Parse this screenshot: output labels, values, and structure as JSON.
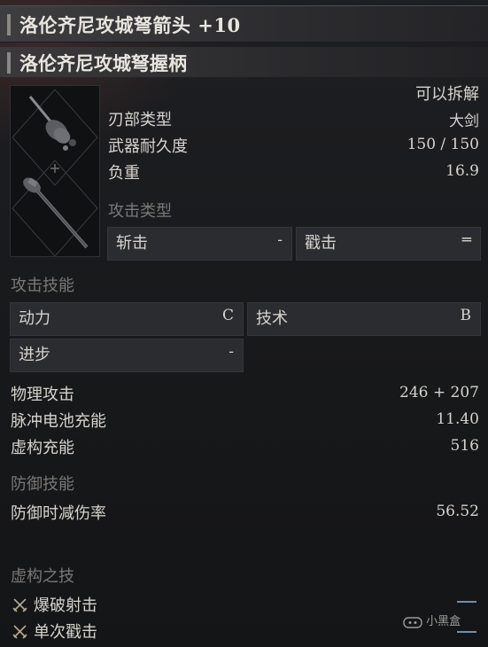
{
  "header": {
    "title": "洛伦齐尼攻城弩箭头 +10"
  },
  "sub_header": {
    "title": "洛伦齐尼攻城弩握柄"
  },
  "info": {
    "detachable": "可以拆解",
    "rows": [
      {
        "label": "刃部类型",
        "value": "大剑"
      },
      {
        "label": "武器耐久度",
        "value": "150 / 150"
      },
      {
        "label": "负重",
        "value": "16.9"
      }
    ]
  },
  "attack_type": {
    "label": "攻击类型",
    "boxes": [
      {
        "label": "斩击",
        "value": "-"
      },
      {
        "label": "戳击",
        "value": "═"
      }
    ]
  },
  "attack_skill": {
    "label": "攻击技能",
    "boxes": [
      {
        "label": "动力",
        "value": "C"
      },
      {
        "label": "技术",
        "value": "B"
      },
      {
        "label": "进步",
        "value": "-"
      }
    ]
  },
  "stats": [
    {
      "label": "物理攻击",
      "value": "246 + 207"
    },
    {
      "label": "脉冲电池充能",
      "value": "11.40"
    },
    {
      "label": "虚构充能",
      "value": "516"
    }
  ],
  "defense_skill": {
    "label": "防御技能",
    "rows": [
      {
        "label": "防御时减伤率",
        "value": "56.52"
      }
    ]
  },
  "fable_arts": {
    "label": "虚构之技",
    "items": [
      {
        "label": "爆破射击",
        "icon": "crossed-swords-icon"
      },
      {
        "label": "单次戳击",
        "icon": "crossed-swords-icon"
      }
    ]
  },
  "watermark": {
    "text": "小黑盒"
  },
  "colors": {
    "background": "#18191b",
    "header": "#3e3d3f",
    "box": "#2b2c2f",
    "muted_label": "#7a7875",
    "text": "#d6d3cd"
  }
}
